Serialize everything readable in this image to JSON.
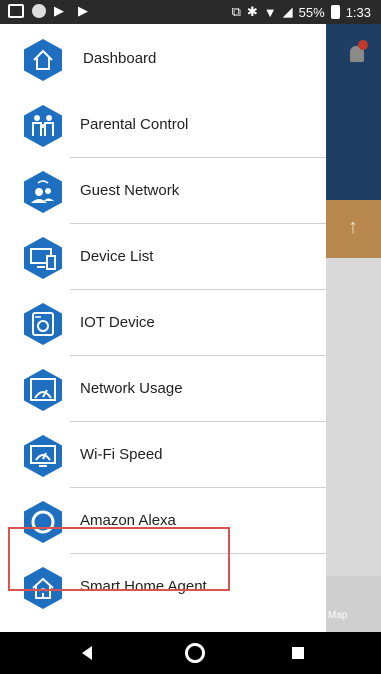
{
  "status_bar": {
    "battery": "55%",
    "time": "1:33"
  },
  "drawer": {
    "items": [
      {
        "label": "Dashboard",
        "icon": "home-icon"
      },
      {
        "label": "Parental Control",
        "icon": "family-icon"
      },
      {
        "label": "Guest Network",
        "icon": "guest-users-icon"
      },
      {
        "label": "Device List",
        "icon": "devices-icon"
      },
      {
        "label": "IOT Device",
        "icon": "washer-icon"
      },
      {
        "label": "Network Usage",
        "icon": "gauge-icon"
      },
      {
        "label": "Wi-Fi Speed",
        "icon": "speedometer-monitor-icon"
      },
      {
        "label": "Amazon Alexa",
        "icon": "alexa-ring-icon"
      },
      {
        "label": "Smart Home Agent",
        "icon": "smart-home-icon"
      }
    ]
  },
  "background": {
    "bottom_tab_label": "Map"
  },
  "colors": {
    "icon_blue": "#1f6fc0",
    "highlight": "#d9534f",
    "header_navy": "#1f3e63"
  }
}
